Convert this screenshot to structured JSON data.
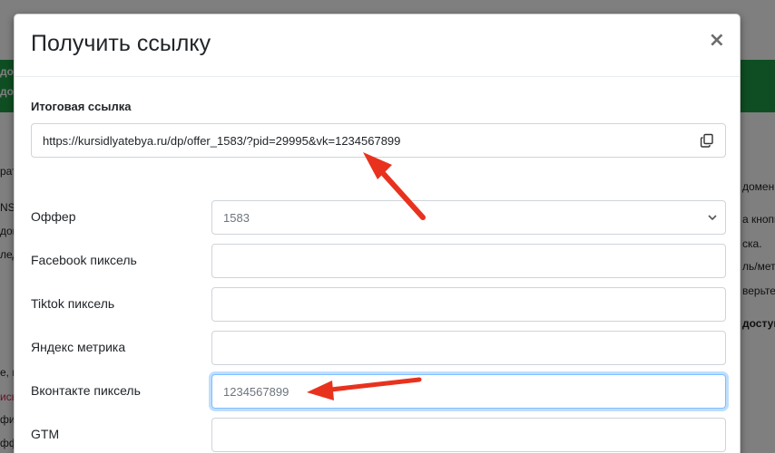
{
  "modal": {
    "title": "Получить ссылку",
    "close_symbol": "×",
    "result_label": "Итоговая ссылка",
    "result_url": "https://kursidlyatebya.ru/dp/offer_1583/?pid=29995&vk=1234567899"
  },
  "form": {
    "offer": {
      "label": "Оффер",
      "value": "1583"
    },
    "facebook": {
      "label": "Facebook пиксель",
      "value": ""
    },
    "tiktok": {
      "label": "Tiktok пиксель",
      "value": ""
    },
    "yandex": {
      "label": "Яндекс метрика",
      "value": ""
    },
    "vk": {
      "label": "Вконтакте пиксель",
      "value": "1234567899"
    },
    "gtm": {
      "label": "GTM",
      "value": ""
    }
  },
  "background": {
    "green_lines": [
      "дом",
      "дол"
    ],
    "left_lines": [
      "рат",
      "NS",
      "дом",
      "лед",
      "е, в",
      "ись",
      "фи",
      "фф"
    ],
    "right_lines": [
      "домен",
      "а кнопк",
      "ска.",
      "ль/метр",
      "верьте",
      "доступ"
    ]
  },
  "colors": {
    "green_bar": "#1f9d44",
    "arrow": "#e8321e",
    "focus_border": "#80bdff"
  }
}
